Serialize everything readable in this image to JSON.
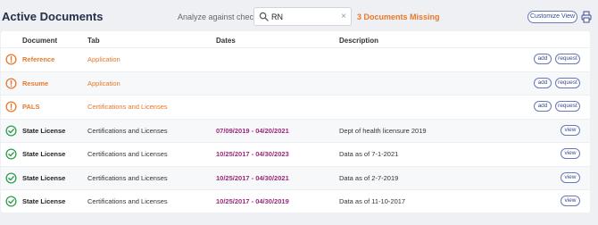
{
  "header": {
    "title": "Active Documents",
    "analyze_label": "Analyze against checklist",
    "search_value": "RN",
    "clear_glyph": "×",
    "missing_text": "3 Documents Missing",
    "customize_label": "Customize View"
  },
  "columns": {
    "document": "Document",
    "tab": "Tab",
    "dates": "Dates",
    "description": "Description"
  },
  "rows": [
    {
      "status": "missing",
      "document": "Reference",
      "tab": "Application",
      "dates": "",
      "description": "",
      "actions": [
        "add",
        "request"
      ]
    },
    {
      "status": "missing",
      "document": "Resume",
      "tab": "Application",
      "dates": "",
      "description": "",
      "actions": [
        "add",
        "request"
      ]
    },
    {
      "status": "missing",
      "document": "PALS",
      "tab": "Certifications and Licenses",
      "dates": "",
      "description": "",
      "actions": [
        "add",
        "request"
      ]
    },
    {
      "status": "ok",
      "document": "State License",
      "tab": "Certifications and Licenses",
      "dates": "07/09/2019 - 04/20/2021",
      "description": "Dept of health licensure 2019",
      "actions": [
        "view"
      ]
    },
    {
      "status": "ok",
      "document": "State License",
      "tab": "Certifications and Licenses",
      "dates": "10/25/2017 - 04/30/2023",
      "description": "Data as of 7-1-2021",
      "actions": [
        "view"
      ]
    },
    {
      "status": "ok",
      "document": "State License",
      "tab": "Certifications and Licenses",
      "dates": "10/25/2017 - 04/30/2021",
      "description": "Data as of 2-7-2019",
      "actions": [
        "view"
      ]
    },
    {
      "status": "ok",
      "document": "State License",
      "tab": "Certifications and Licenses",
      "dates": "10/25/2017 - 04/30/2019",
      "description": "Data as of 11-10-2017",
      "actions": [
        "view"
      ]
    }
  ],
  "colors": {
    "missing": "#e8782a",
    "ok": "#2e9e4e",
    "dates": "#9a2a7a",
    "accent": "#6878b8"
  },
  "icons": {
    "search": "search-icon",
    "clear": "close-icon",
    "print": "printer-icon",
    "missing": "warning-circle-icon",
    "ok": "check-circle-icon"
  }
}
